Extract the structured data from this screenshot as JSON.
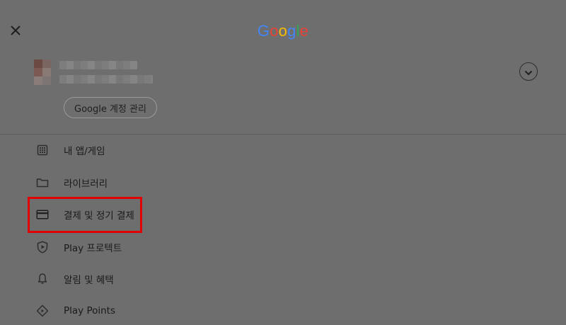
{
  "header": {
    "close_icon": "close-icon",
    "logo_letters": [
      {
        "ch": "G",
        "color": "#4285f4"
      },
      {
        "ch": "o",
        "color": "#ea4335"
      },
      {
        "ch": "o",
        "color": "#fbbc05"
      },
      {
        "ch": "g",
        "color": "#4285f4"
      },
      {
        "ch": "l",
        "color": "#34a853"
      },
      {
        "ch": "e",
        "color": "#ea4335"
      }
    ]
  },
  "account": {
    "manage_label": "Google 계정 관리",
    "expand_icon": "chevron-down-icon"
  },
  "menu": {
    "items": [
      {
        "label": "내 앱/게임",
        "icon": "apps-grid-icon"
      },
      {
        "label": "라이브러리",
        "icon": "folder-icon"
      },
      {
        "label": "결제 및 정기 결제",
        "icon": "credit-card-icon",
        "highlighted": true
      },
      {
        "label": "Play 프로텍트",
        "icon": "shield-play-icon"
      },
      {
        "label": "알림 및 혜택",
        "icon": "bell-icon"
      },
      {
        "label": "Play Points",
        "icon": "diamond-icon"
      }
    ]
  },
  "colors": {
    "overlay_bg": "#6e6e6e",
    "highlight_border": "#e00000"
  }
}
